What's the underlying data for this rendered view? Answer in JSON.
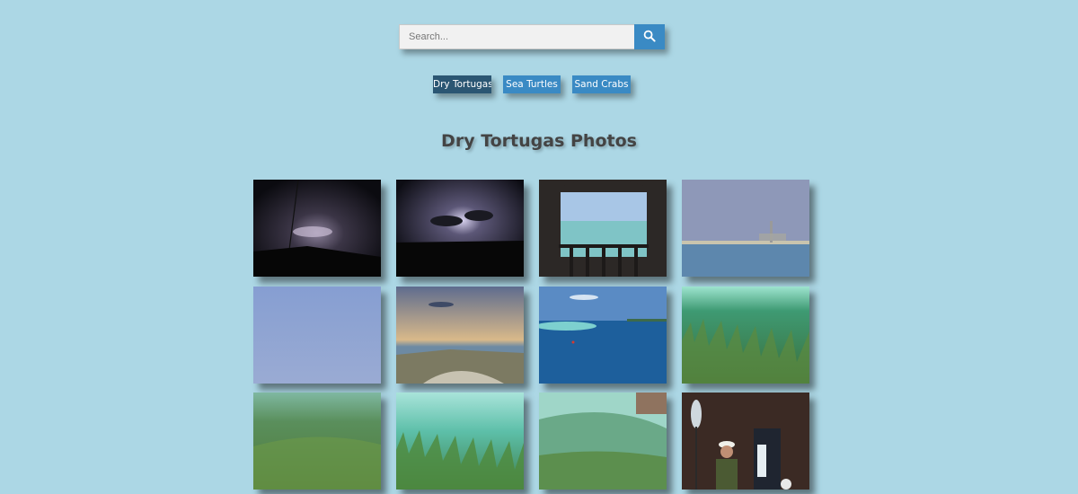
{
  "search": {
    "placeholder": "Search...",
    "icon": "search-icon",
    "button_color": "#3a8ac4"
  },
  "categories": [
    {
      "label": "Dry Tortugas",
      "active": true
    },
    {
      "label": "Sea Turtles",
      "active": false
    },
    {
      "label": "Sand Crabs",
      "active": false
    }
  ],
  "gallery": {
    "title": "Dry Tortugas Photos",
    "photos": [
      {
        "subject": "night lightning storm over horizon"
      },
      {
        "subject": "lightning in clouds over dark shoreline"
      },
      {
        "subject": "view of sea through fort brick archway"
      },
      {
        "subject": "lighthouse on distant island across water"
      },
      {
        "subject": "hazy blue sky over sea"
      },
      {
        "subject": "sunset over beach and dunes"
      },
      {
        "subject": "turquoise bay with island and boat"
      },
      {
        "subject": "underwater seagrass bed"
      },
      {
        "subject": "underwater seagrass meadow"
      },
      {
        "subject": "seagrass in clear shallow water"
      },
      {
        "subject": "split view of water surface near fort"
      },
      {
        "subject": "person in hat holding paddle by brick wall"
      }
    ]
  },
  "colors": {
    "background": "#acd7e5",
    "active_button": "#2b5673",
    "button": "#3a8ac4",
    "title_text": "#444444"
  }
}
